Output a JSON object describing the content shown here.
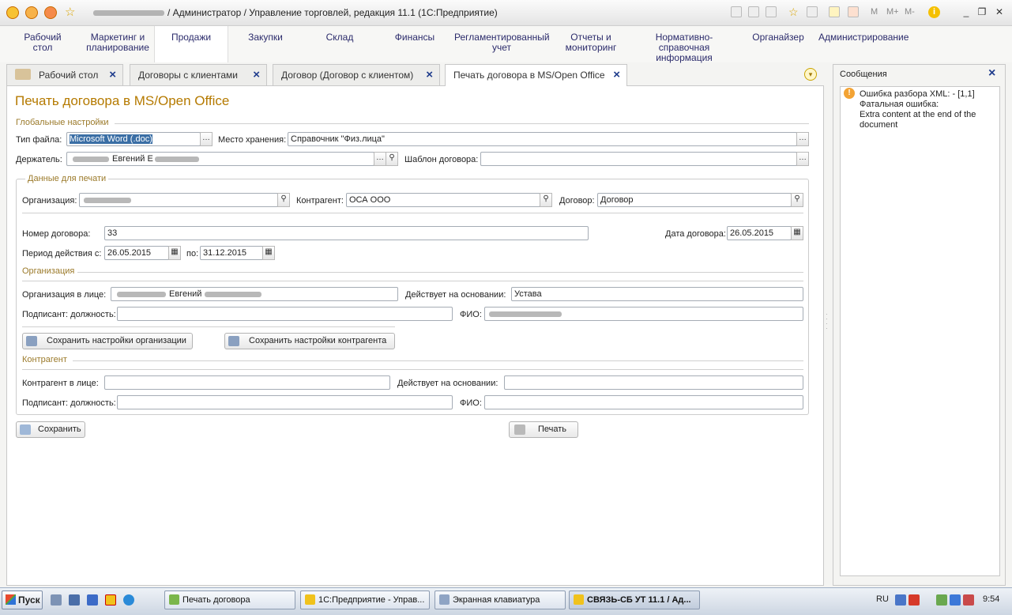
{
  "window": {
    "title": "/ Администратор / Управление торговлей, редакция 11.1  (1С:Предприятие)",
    "memory_buttons": [
      "M",
      "M+",
      "M-"
    ]
  },
  "sections": [
    {
      "label": "Рабочий стол"
    },
    {
      "label": "Маркетинг и планирование"
    },
    {
      "label": "Продажи"
    },
    {
      "label": "Закупки"
    },
    {
      "label": "Склад"
    },
    {
      "label": "Финансы"
    },
    {
      "label": "Регламентированный учет"
    },
    {
      "label": "Отчеты и мониторинг"
    },
    {
      "label": "Нормативно-справочная информация"
    },
    {
      "label": "Органайзер"
    },
    {
      "label": "Администрирование"
    }
  ],
  "tabs": [
    {
      "label": "Рабочий стол"
    },
    {
      "label": "Договоры с клиентами"
    },
    {
      "label": "Договор (Договор с клиентом)"
    },
    {
      "label": "Печать договора в MS/Open Office"
    }
  ],
  "form": {
    "title": "Печать договора в MS/Open Office",
    "global_group": "Глобальные настройки",
    "file_type_label": "Тип файла:",
    "file_type_value": "Microsoft Word (.doc)",
    "storage_label": "Место хранения:",
    "storage_value": "Справочник \"Физ.лица\"",
    "holder_label": "Держатель:",
    "holder_value": "Евгений Е",
    "template_label": "Шаблон договора:",
    "template_value": "",
    "print_data_group": "Данные для печати",
    "org_label": "Организация:",
    "org_value": "",
    "counterparty_label": "Контрагент:",
    "counterparty_value": "ОСА ООО",
    "contract_label": "Договор:",
    "contract_value": "Договор",
    "contract_no_label": "Номер договора:",
    "contract_no_value": "33",
    "contract_date_label": "Дата договора:",
    "contract_date_value": "26.05.2015",
    "period_label": "Период действия с:",
    "period_from": "26.05.2015",
    "period_to_label": "по:",
    "period_to": "31.12.2015",
    "org_group": "Организация",
    "org_person_label": "Организация в лице:",
    "org_person_value": "Евгений",
    "org_basis_label": "Действует на основании:",
    "org_basis_value": "Устава",
    "org_signer_label": "Подписант: должность:",
    "org_signer_value": "",
    "org_fio_label": "ФИО:",
    "org_fio_value": "",
    "save_org_btn": "Сохранить настройки организации",
    "save_cp_btn": "Сохранить настройки контрагента",
    "cp_group": "Контрагент",
    "cp_person_label": "Контрагент в лице:",
    "cp_person_value": "",
    "cp_basis_label": "Действует на основании:",
    "cp_basis_value": "",
    "cp_signer_label": "Подписант: должность:",
    "cp_signer_value": "",
    "cp_fio_label": "ФИО:",
    "cp_fio_value": "",
    "save_btn": "Сохранить",
    "print_btn": "Печать"
  },
  "messages": {
    "title": "Сообщения",
    "items": [
      {
        "text1": "Ошибка разбора XML:  - [1,1]",
        "text2": "Фатальная ошибка:",
        "text3": "Extra content at the end of the",
        "text4": "document"
      }
    ]
  },
  "taskbar": {
    "start": "Пуск",
    "tasks": [
      {
        "label": "Печать договора"
      },
      {
        "label": "1С:Предприятие - Управ..."
      },
      {
        "label": "Экранная клавиатура"
      },
      {
        "label": "СВЯЗЬ-СБ УТ 11.1 / Ад..."
      }
    ],
    "lang": "RU",
    "clock": "9:54"
  }
}
